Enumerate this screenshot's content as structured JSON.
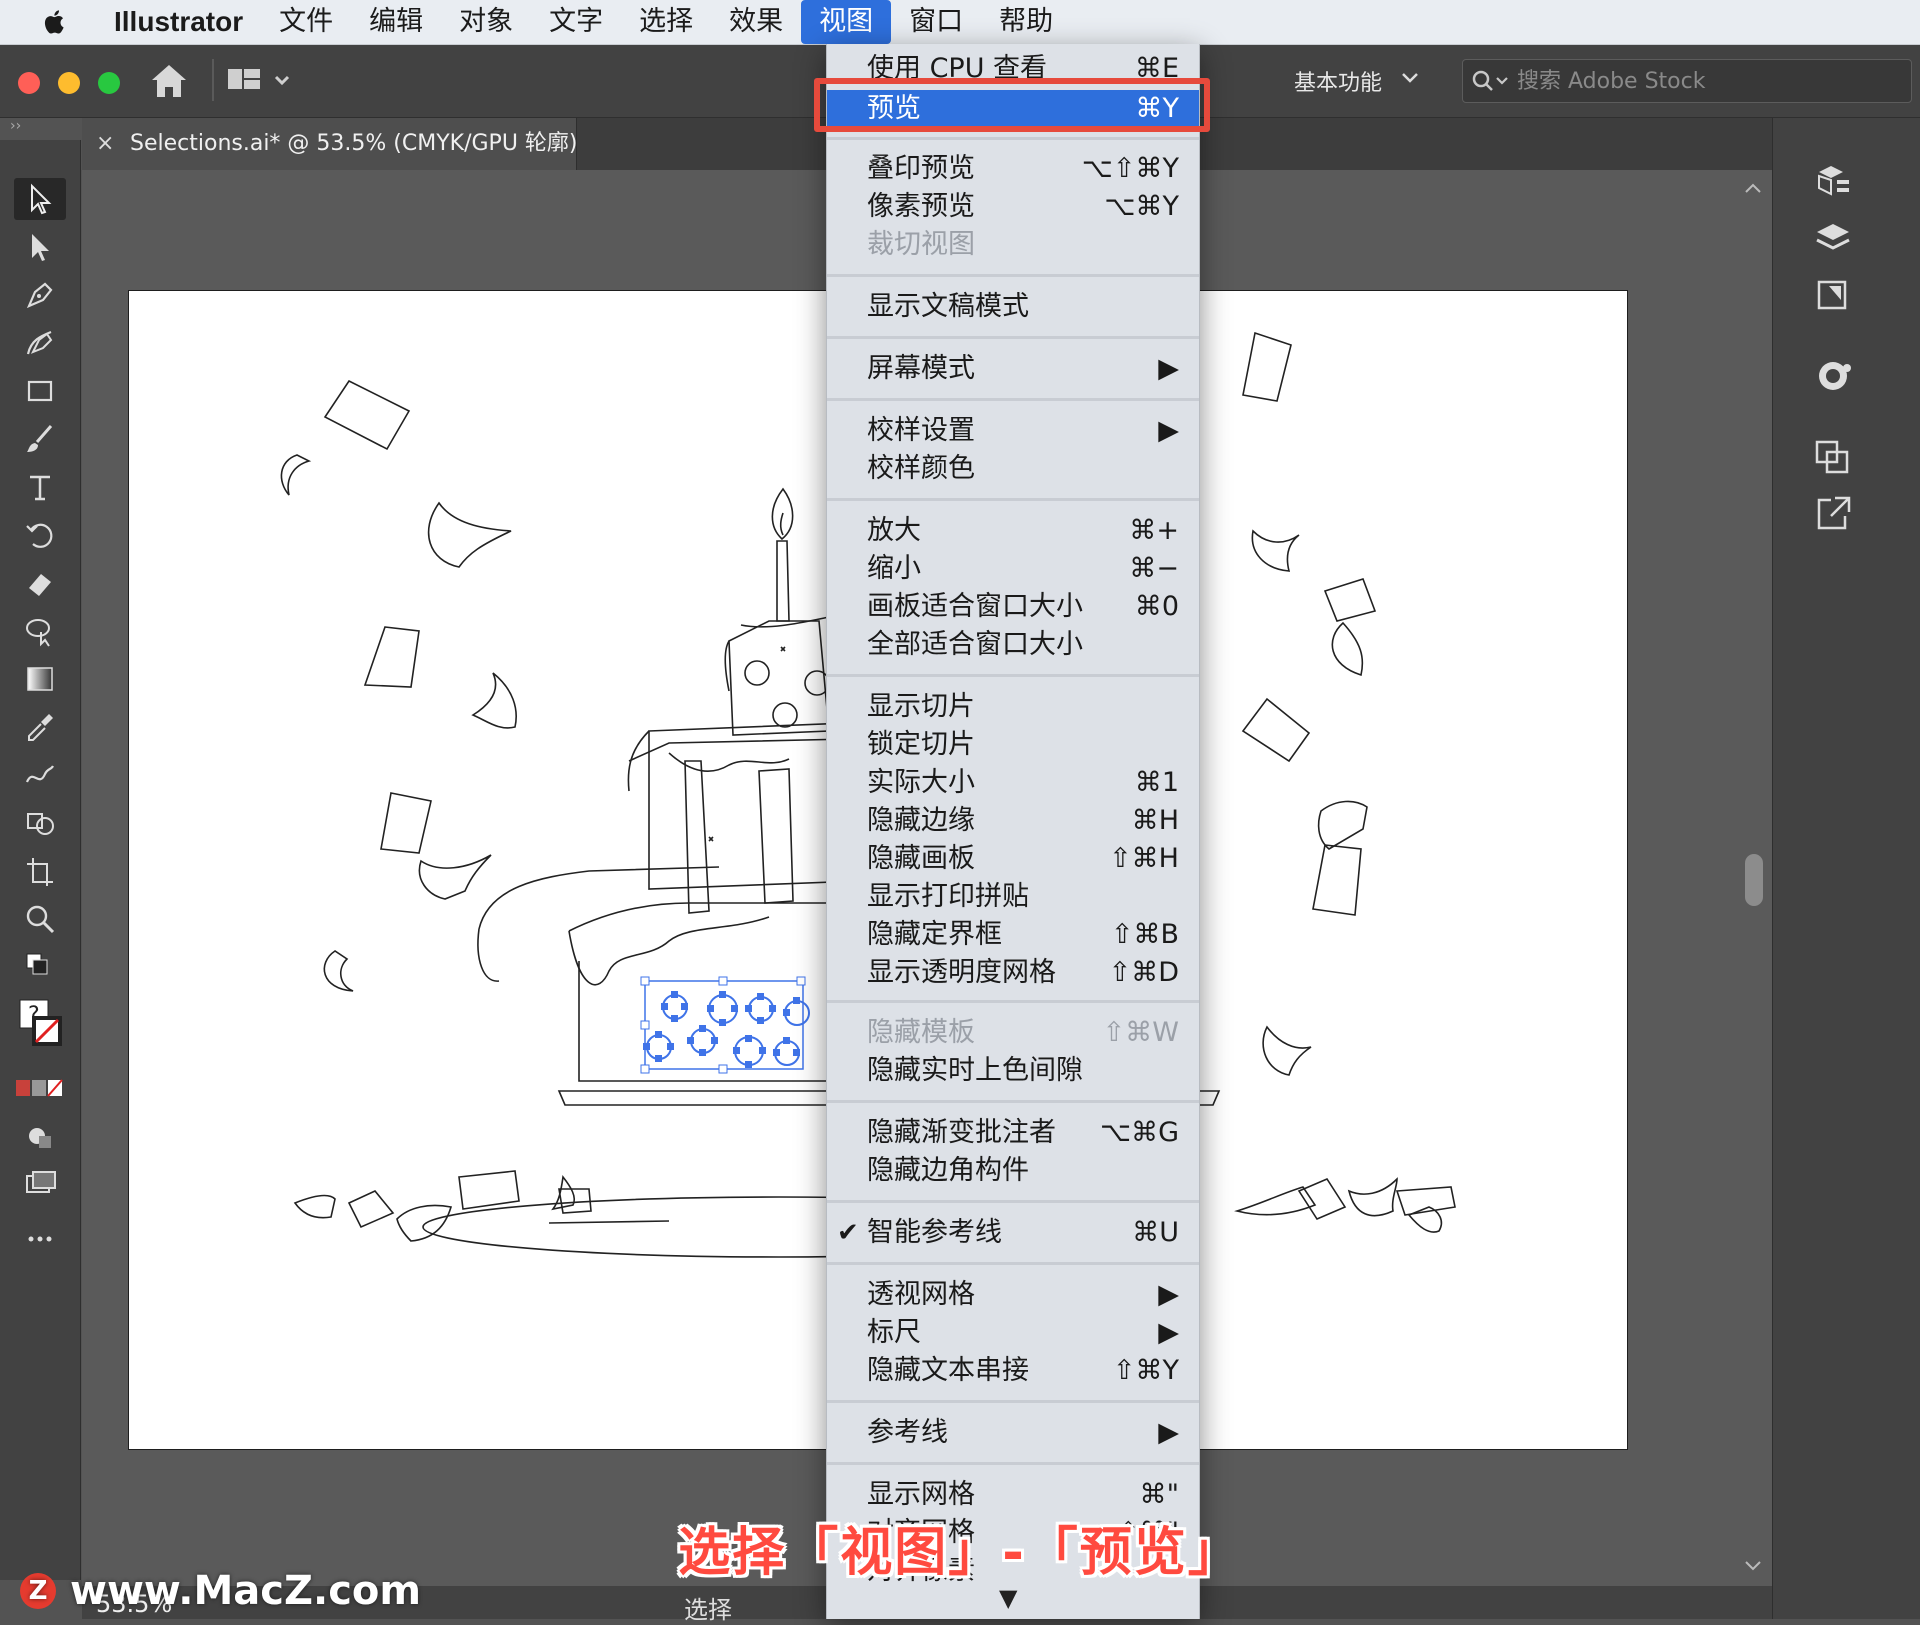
{
  "menubar": {
    "app_name": "Illustrator",
    "items": [
      "文件",
      "编辑",
      "对象",
      "文字",
      "选择",
      "效果",
      "视图",
      "窗口",
      "帮助"
    ],
    "active_item": "视图"
  },
  "appbar": {
    "workspace_label": "基本功能",
    "search_placeholder": "搜索 Adobe Stock",
    "traffic_colors": [
      "#ff5f57",
      "#febc2e",
      "#28c840"
    ]
  },
  "document_tab": {
    "close_glyph": "×",
    "title": "Selections.ai* @ 53.5% (CMYK/GPU 轮廓)"
  },
  "panel_collapse": {
    "left": "››",
    "right": "‹‹"
  },
  "view_menu": {
    "items": [
      {
        "label": "使用 CPU 查看",
        "shortcut": "⌘E"
      },
      {
        "label": "预览",
        "shortcut": "⌘Y"
      },
      {
        "label": "叠印预览",
        "shortcut": "⌥⇧⌘Y"
      },
      {
        "label": "像素预览",
        "shortcut": "⌥⌘Y"
      },
      {
        "label": "裁切视图",
        "shortcut": ""
      },
      {
        "label": "显示文稿模式",
        "shortcut": ""
      },
      {
        "label": "屏幕模式",
        "shortcut": "▶"
      },
      {
        "label": "校样设置",
        "shortcut": "▶"
      },
      {
        "label": "校样颜色",
        "shortcut": ""
      },
      {
        "label": "放大",
        "shortcut": "⌘+"
      },
      {
        "label": "缩小",
        "shortcut": "⌘−"
      },
      {
        "label": "画板适合窗口大小",
        "shortcut": "⌘0"
      },
      {
        "label": "全部适合窗口大小",
        "shortcut": ""
      },
      {
        "label": "显示切片",
        "shortcut": ""
      },
      {
        "label": "锁定切片",
        "shortcut": ""
      },
      {
        "label": "实际大小",
        "shortcut": "⌘1"
      },
      {
        "label": "隐藏边缘",
        "shortcut": "⌘H"
      },
      {
        "label": "隐藏画板",
        "shortcut": "⇧⌘H"
      },
      {
        "label": "显示打印拼贴",
        "shortcut": ""
      },
      {
        "label": "隐藏定界框",
        "shortcut": "⇧⌘B"
      },
      {
        "label": "显示透明度网格",
        "shortcut": "⇧⌘D"
      },
      {
        "label": "隐藏模板",
        "shortcut": "⇧⌘W"
      },
      {
        "label": "隐藏实时上色间隙",
        "shortcut": ""
      },
      {
        "label": "隐藏渐变批注者",
        "shortcut": "⌥⌘G"
      },
      {
        "label": "隐藏边角构件",
        "shortcut": ""
      },
      {
        "label": "智能参考线",
        "shortcut": "⌘U",
        "check": "✔"
      },
      {
        "label": "透视网格",
        "shortcut": "▶"
      },
      {
        "label": "标尺",
        "shortcut": "▶"
      },
      {
        "label": "隐藏文本串接",
        "shortcut": "⇧⌘Y"
      },
      {
        "label": "参考线",
        "shortcut": "▶"
      },
      {
        "label": "显示网格",
        "shortcut": "⌘\""
      },
      {
        "label": "对齐网格",
        "shortcut": "⇧⌘\""
      },
      {
        "label": "对齐像素",
        "shortcut": ""
      }
    ],
    "more_arrow": "▼"
  },
  "statusbar": {
    "zoom": "53.5%",
    "tool_name": "选择"
  },
  "caption": "选择「视图」-「预览」",
  "watermark": {
    "logo": "Z",
    "text": "www.MacZ.com"
  },
  "colors": {
    "menu_highlight": "#2e6fdc",
    "callout_red": "#e64a3c",
    "selection_blue": "#3f73e8"
  }
}
